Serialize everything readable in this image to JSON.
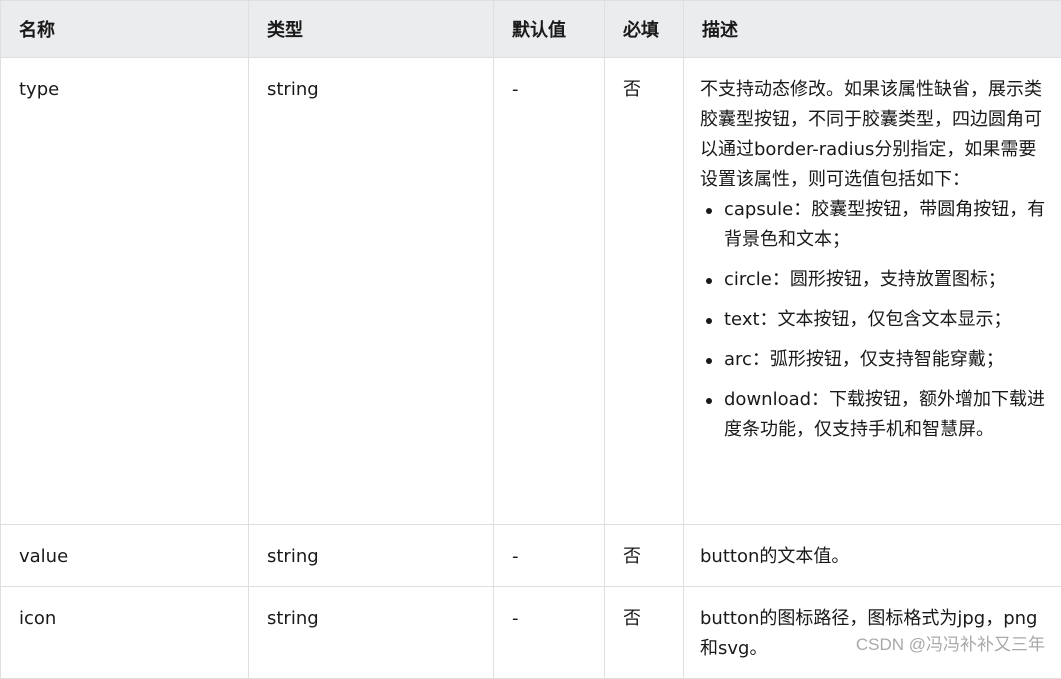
{
  "table": {
    "headers": [
      "名称",
      "类型",
      "默认值",
      "必填",
      "描述"
    ],
    "rows": [
      {
        "name": "type",
        "type": "string",
        "default": "-",
        "required": "否",
        "description": "不支持动态修改。如果该属性缺省，展示类胶囊型按钮，不同于胶囊类型，四边圆角可以通过border-radius分别指定，如果需要设置该属性，则可选值包括如下：",
        "options": [
          "capsule：胶囊型按钮，带圆角按钮，有背景色和文本；",
          "circle：圆形按钮，支持放置图标；",
          "text：文本按钮，仅包含文本显示；",
          "arc：弧形按钮，仅支持智能穿戴；",
          "download：下载按钮，额外增加下载进度条功能，仅支持手机和智慧屏。"
        ]
      },
      {
        "name": "value",
        "type": "string",
        "default": "-",
        "required": "否",
        "description": "button的文本值。"
      },
      {
        "name": "icon",
        "type": "string",
        "default": "-",
        "required": "否",
        "description": "button的图标路径，图标格式为jpg，png和svg。"
      }
    ]
  },
  "watermark": "CSDN @冯冯补补又三年"
}
